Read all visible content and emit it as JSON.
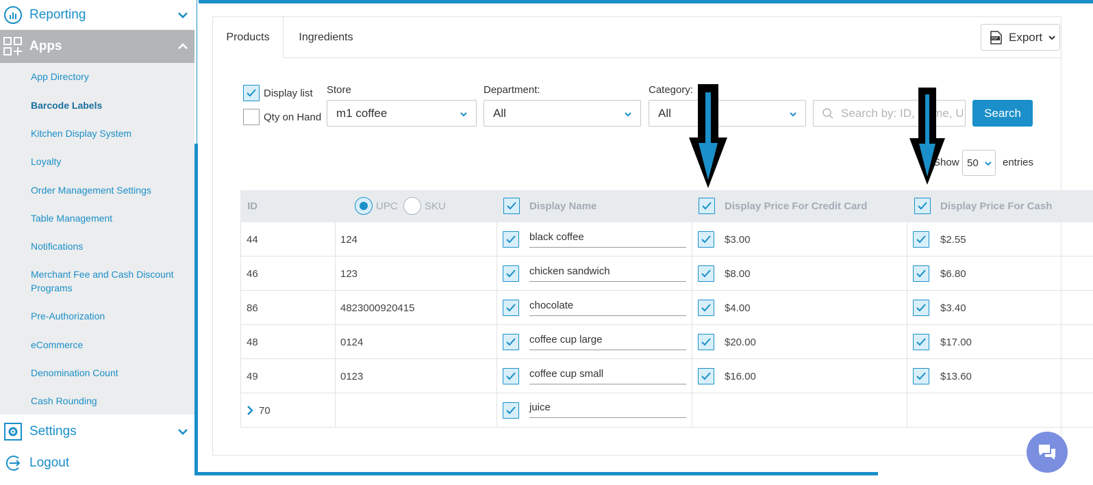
{
  "sidebar": {
    "reporting_label": "Reporting",
    "apps_label": "Apps",
    "apps_items": [
      {
        "label": "App Directory"
      },
      {
        "label": "Barcode Labels"
      },
      {
        "label": "Kitchen Display System"
      },
      {
        "label": "Loyalty"
      },
      {
        "label": "Order Management Settings"
      },
      {
        "label": "Table Management"
      },
      {
        "label": "Notifications"
      },
      {
        "label": "Merchant Fee and Cash Discount Programs"
      },
      {
        "label": "Pre-Authorization"
      },
      {
        "label": "eCommerce"
      },
      {
        "label": "Denomination Count"
      },
      {
        "label": "Cash Rounding"
      }
    ],
    "active_item": "Barcode Labels",
    "settings_label": "Settings",
    "logout_label": "Logout"
  },
  "tabs": [
    {
      "label": "Products"
    },
    {
      "label": "Ingredients"
    }
  ],
  "export": {
    "label": "Export",
    "icon": "pdf-icon"
  },
  "filters": {
    "display_list_label": "Display list",
    "qty_on_hand_label": "Qty on Hand",
    "display_list_checked": true,
    "qty_on_hand_checked": false,
    "store_label": "Store",
    "store_value": "m1 coffee",
    "department_label": "Department:",
    "department_value": "All",
    "category_label": "Category:",
    "category_value": "All",
    "search_placeholder": "Search by: ID, Name, UPC",
    "search_button": "Search",
    "show_label": "Show",
    "show_value": "50",
    "entries_label": "entries"
  },
  "table": {
    "headers": {
      "id": "ID",
      "upc": "UPC",
      "sku": "SKU",
      "display_name": "Display Name",
      "credit": "Display Price For Credit Card",
      "cash": "Display Price For Cash"
    },
    "upc_selected": true,
    "rows": [
      {
        "id": "44",
        "code": "124",
        "name": "black coffee",
        "credit": "$3.00",
        "cash": "$2.55"
      },
      {
        "id": "46",
        "code": "123",
        "name": "chicken sandwich",
        "credit": "$8.00",
        "cash": "$6.80"
      },
      {
        "id": "86",
        "code": "4823000920415",
        "name": "chocolate",
        "credit": "$4.00",
        "cash": "$3.40"
      },
      {
        "id": "48",
        "code": "0124",
        "name": "coffee cup large",
        "credit": "$20.00",
        "cash": "$17.00"
      },
      {
        "id": "49",
        "code": "0123",
        "name": "coffee cup small",
        "credit": "$16.00",
        "cash": "$13.60"
      },
      {
        "id": "70",
        "code": "",
        "name": "juice",
        "credit": "",
        "cash": ""
      }
    ]
  },
  "colors": {
    "accent": "#1a8fc9",
    "annotation_arrow": "#000000"
  }
}
